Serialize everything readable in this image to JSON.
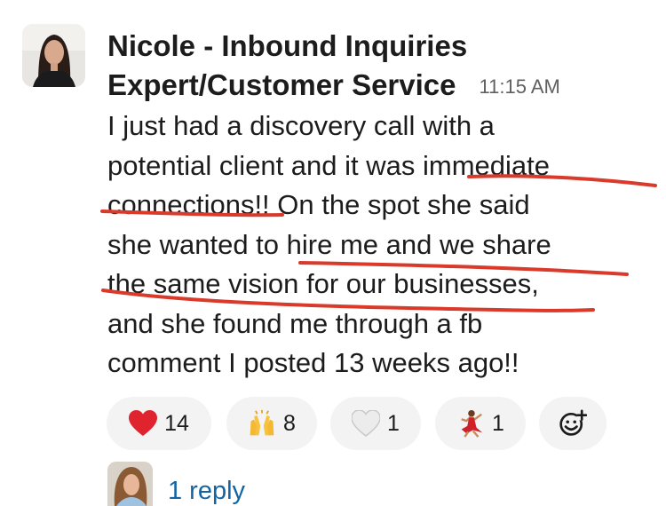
{
  "message": {
    "author_line1": "Nicole - Inbound Inquiries",
    "author_line2": "Expert/Customer Service",
    "timestamp": "11:15 AM",
    "lines": [
      "I just had a discovery call with a",
      "potential client and it was immediate",
      "connections!! On the spot she said",
      "she wanted to hire me and we share",
      "the same vision for our businesses,",
      "and she found me through a fb",
      "comment I posted 13 weeks ago!!"
    ]
  },
  "reactions": [
    {
      "icon": "red-heart-icon",
      "count": "14"
    },
    {
      "icon": "raised-hands-icon",
      "count": "8"
    },
    {
      "icon": "white-heart-icon",
      "count": "1"
    },
    {
      "icon": "dancer-icon",
      "count": "1"
    }
  ],
  "thread": {
    "reply_label": "1 reply"
  },
  "colors": {
    "text": "#1d1c1d",
    "timestamp": "#616061",
    "link": "#1264a3",
    "reaction_bg": "#f3f3f3",
    "annotation": "#d93a2b"
  }
}
